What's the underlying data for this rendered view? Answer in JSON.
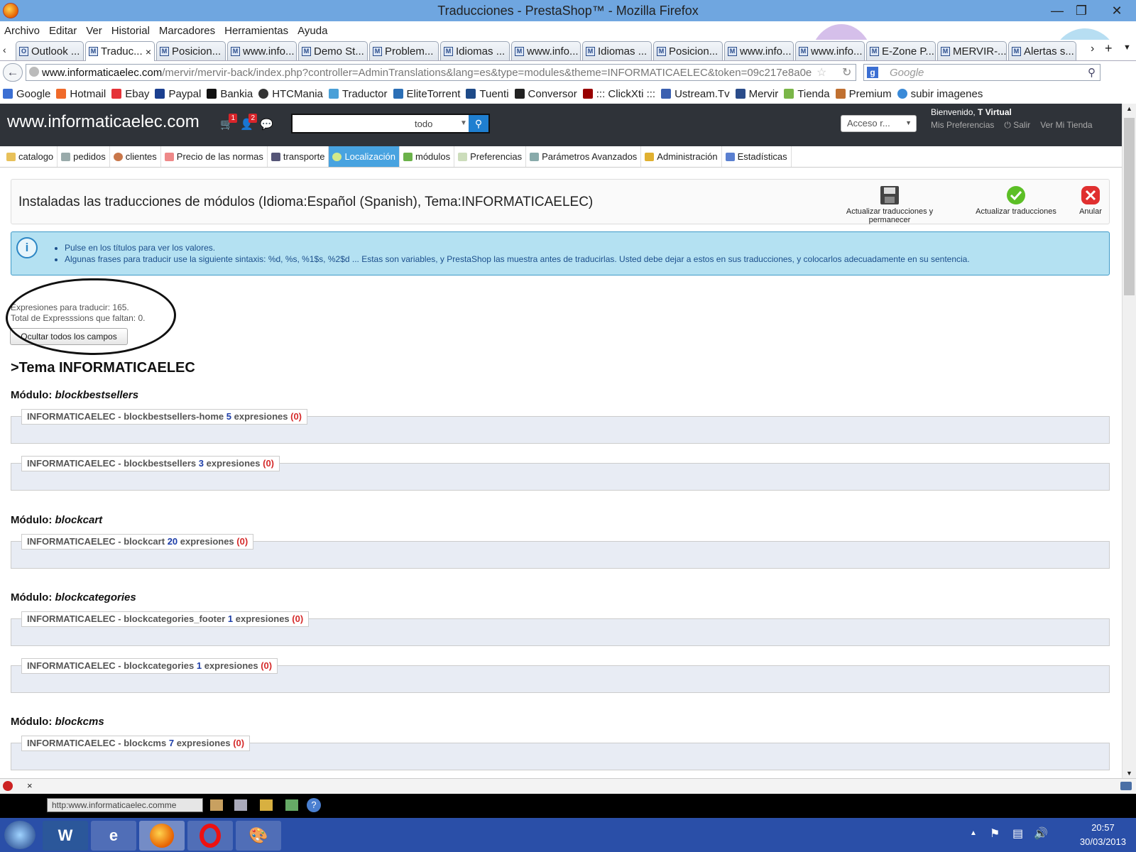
{
  "window": {
    "title": "Traducciones - PrestaShop™ - Mozilla Firefox"
  },
  "menu": [
    "Archivo",
    "Editar",
    "Ver",
    "Historial",
    "Marcadores",
    "Herramientas",
    "Ayuda"
  ],
  "tabs": [
    "Outlook ...",
    "Traduc...",
    "Posicion...",
    "www.info...",
    "Demo St...",
    "Problem...",
    "Idiomas ...",
    "www.info...",
    "Idiomas ...",
    "Posicion...",
    "www.info...",
    "www.info...",
    "E-Zone P...",
    "MERVIR-...",
    "Alertas s..."
  ],
  "url": {
    "host": "www.informaticaelec.com",
    "path": "/mervir/mervir-back/index.php?controller=AdminTranslations&lang=es&type=modules&theme=INFORMATICAELEC&token=09c217e8a0e"
  },
  "search_placeholder": "Google",
  "bookmarks": [
    "Google",
    "Hotmail",
    "Ebay",
    "Paypal",
    "Bankia",
    "HTCMania",
    "Traductor",
    "EliteTorrent",
    "Tuenti",
    "Conversor",
    "::: ClickXti :::",
    "Ustream.Tv",
    "Mervir",
    "Tienda",
    "Premium",
    "subir imagenes"
  ],
  "admin": {
    "shop_name": "www.informaticaelec.com",
    "badges": {
      "orders": "1",
      "customers": "2"
    },
    "search_select": "todo",
    "quick_access": "Acceso r...",
    "welcome_prefix": "Bienvenido, ",
    "welcome_user": "T Virtual",
    "links": [
      "Mis Preferencias",
      "Salir",
      "Ver Mi Tienda"
    ]
  },
  "nav": [
    "catalogo",
    "pedidos",
    "clientes",
    "Precio de las normas",
    "transporte",
    "Localización",
    "módulos",
    "Preferencias",
    "Parámetros Avanzados",
    "Administración",
    "Estadísticas"
  ],
  "toolbar": {
    "title": "Instaladas las traducciones de módulos (Idioma:Español (Spanish), Tema:INFORMATICAELEC)",
    "save_stay": "Actualizar traducciones y permanecer",
    "save": "Actualizar traducciones",
    "cancel": "Anular"
  },
  "info": [
    "Pulse en los títulos para ver los valores.",
    "Algunas frases para traducir use la siguiente sintaxis: %d, %s, %1$s, %2$d ... Estas son variables, y PrestaShop las muestra antes de traducirlas. Usted debe dejar a estos en sus traducciones, y colocarlos adecuadamente en su sentencia."
  ],
  "counts": {
    "to_translate": "Expresiones para traducir: 165.",
    "missing": "Total de Expresssions que faltan: 0."
  },
  "hide_button": "Ocultar todos los campos",
  "theme_heading": ">Tema INFORMATICAELEC",
  "module_label": "Módulo: ",
  "modules": [
    {
      "name": "blockbestsellers"
    },
    {
      "name": "blockcart"
    },
    {
      "name": "blockcategories"
    },
    {
      "name": "blockcms"
    }
  ],
  "fieldsets": [
    {
      "prefix": "INFORMATICAELEC - blockbestsellers-home",
      "count": "5",
      "word": "expresiones",
      "missing": "(0)"
    },
    {
      "prefix": "INFORMATICAELEC - blockbestsellers",
      "count": "3",
      "word": "expresiones",
      "missing": "(0)"
    },
    {
      "prefix": "INFORMATICAELEC - blockcart",
      "count": "20",
      "word": "expresiones",
      "missing": "(0)"
    },
    {
      "prefix": "INFORMATICAELEC - blockcategories_footer",
      "count": "1",
      "word": "expresiones",
      "missing": "(0)"
    },
    {
      "prefix": "INFORMATICAELEC - blockcategories",
      "count": "1",
      "word": "expresiones",
      "missing": "(0)"
    },
    {
      "prefix": "INFORMATICAELEC - blockcms",
      "count": "7",
      "word": "expresiones",
      "missing": "(0)"
    }
  ],
  "status_url": "http:www.informaticaelec.comme",
  "clock": {
    "time": "20:57",
    "date": "30/03/2013"
  },
  "colors": {
    "header_bg": "#2f3339",
    "nav_active": "#48a3e0",
    "info_bg": "#b4e1f2",
    "fieldset_bg": "#e8ecf4",
    "taskbar": "#2a4fa8"
  }
}
